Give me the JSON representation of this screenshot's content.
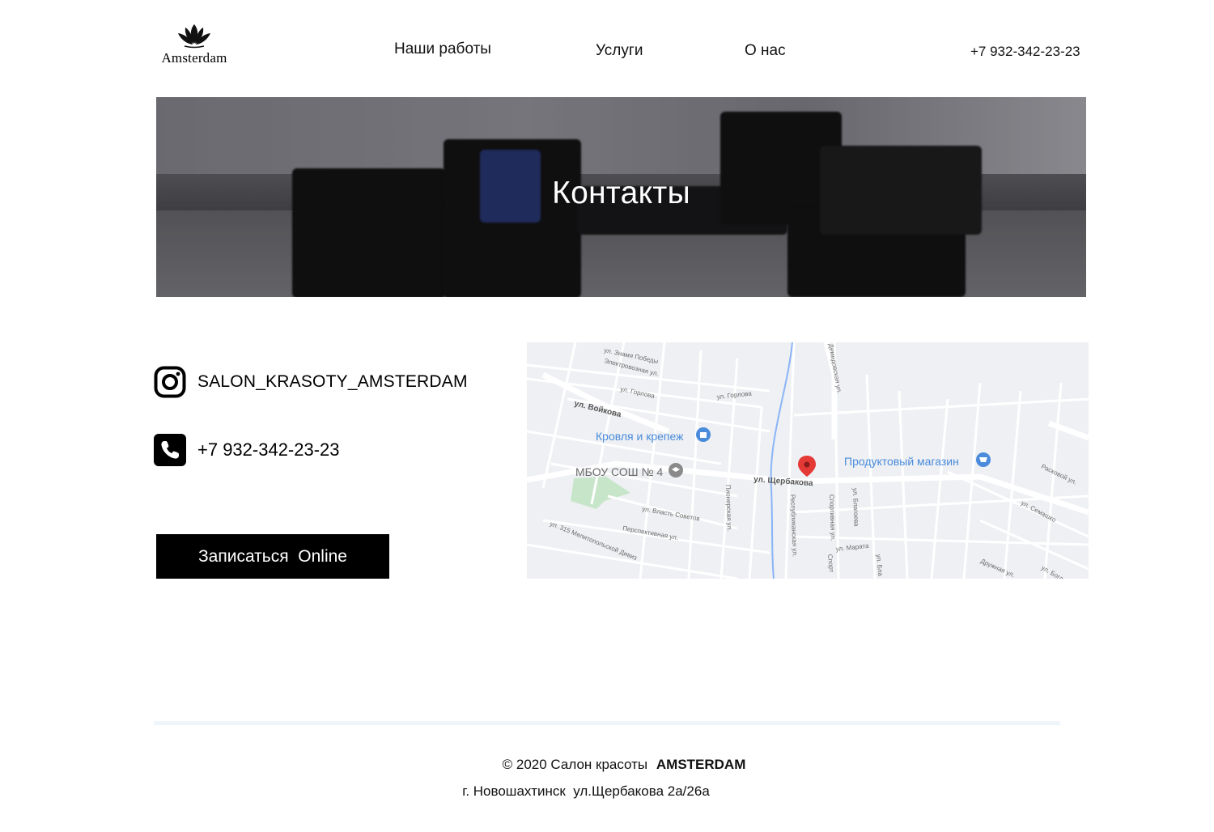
{
  "header": {
    "logo_text": "Amsterdam",
    "nav": [
      {
        "label": "Наши работы"
      },
      {
        "label": "Услуги"
      },
      {
        "label": "О нас"
      }
    ],
    "phone": "+7 932-342-23-23"
  },
  "hero": {
    "title": "Контакты"
  },
  "contacts": {
    "instagram": "SALON_KRASOTY_AMSTERDAM",
    "phone": "+7 932-342-23-23",
    "book_button": "Записаться  Online"
  },
  "map": {
    "labels": {
      "street_1": "ул. Знамя Победы",
      "street_2": "Электровозная ул.",
      "street_3": "ул. Горлова",
      "street_4": "ул. Горлова",
      "street_5": "ул. Войкова",
      "street_6": "ул. Щербакова",
      "street_7": "ул. Власть Советов",
      "street_8": "Перспективная ул.",
      "street_9": "ул. 315 Мелитопольской Дивиз",
      "street_10": "Республиканская ул.",
      "street_11": "Спортивная ул.",
      "street_12": "ул. Благоева",
      "street_13": "ул. Марата",
      "street_14": "ул. Семашко",
      "street_15": "Расковой ул.",
      "street_16": "Дружная ул.",
      "street_17": "ул. Богд",
      "street_18": "Пионерская ул.",
      "street_19": "Демидовская ул.",
      "street_20": "Спорт",
      "street_21": "ул. Бла",
      "poi_1": "Кровля и крепеж",
      "poi_2": "МБОУ СОШ № 4",
      "poi_3": "Продуктовый магазин"
    },
    "colors": {
      "road": "#ffffff",
      "background": "#eef0f3",
      "river": "#8ab4f8",
      "park": "#c7e6c9",
      "poi_blue": "#4a8bdb",
      "pin_red": "#e53935"
    }
  },
  "footer": {
    "copyright_prefix": "© 2020 Салон красоты",
    "copyright_brand": "AMSTERDAM",
    "address": "г. Новошахтинск  ул.Щербакова 2а/26а"
  }
}
